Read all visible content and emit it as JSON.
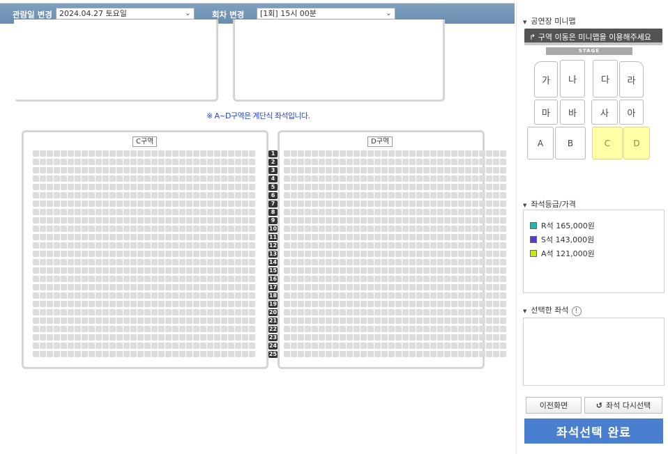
{
  "header": {
    "date_label": "관람일 변경",
    "date_value": "2024.04.27 토요일",
    "session_label": "회차 변경",
    "session_value": "[1회] 15시 00분"
  },
  "seatmap": {
    "notice": "※ A~D구역은 계단식 좌석입니다.",
    "zone_c_label": "C구역",
    "zone_d_label": "D구역",
    "rows": [
      "1",
      "2",
      "3",
      "4",
      "5",
      "6",
      "7",
      "8",
      "9",
      "10",
      "11",
      "12",
      "13",
      "14",
      "15",
      "16",
      "17",
      "18",
      "19",
      "20",
      "21",
      "22",
      "23",
      "24",
      "25"
    ],
    "seats_per_row_c": 32,
    "seats_per_row_d": 32
  },
  "minimap": {
    "title": "공연장 미니맵",
    "hint": "구역 이동은 미니맵을 이용해주세요",
    "stage": "STAGE",
    "zones": {
      "ga": "가",
      "na": "나",
      "da": "다",
      "ra": "라",
      "ma": "마",
      "ba": "바",
      "sa": "사",
      "a_kr": "아",
      "a": "A",
      "b": "B",
      "c": "C",
      "d": "D"
    },
    "highlight_color": "#ffffa8"
  },
  "prices": {
    "title": "좌석등급/가격",
    "items": [
      {
        "label": "R석 165,000원",
        "color": "#20b8b0"
      },
      {
        "label": "S석 143,000원",
        "color": "#5a3ad0"
      },
      {
        "label": "A석 121,000원",
        "color": "#c8e818"
      }
    ]
  },
  "selected": {
    "title": "선택한 좌석"
  },
  "buttons": {
    "prev": "이전화면",
    "reselect": "좌석 다시선택",
    "complete": "좌석선택 완료"
  }
}
